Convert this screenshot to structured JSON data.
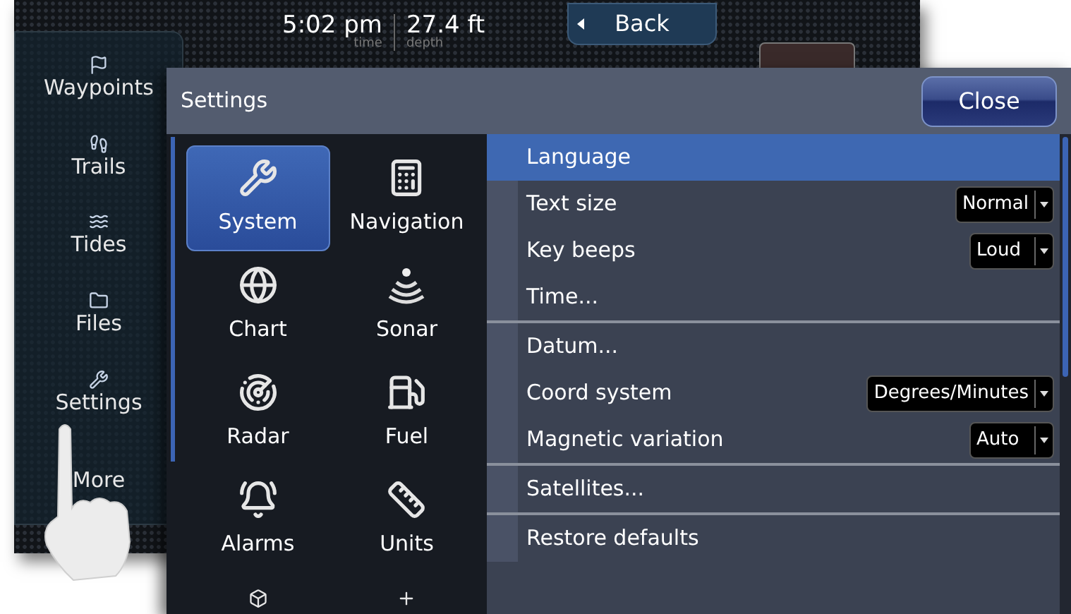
{
  "status": {
    "time": "5:02 pm",
    "time_label": "time",
    "depth": "27.4 ft",
    "depth_label": "depth"
  },
  "back_button": {
    "label": "Back"
  },
  "sidebar": {
    "items": [
      {
        "label": "Waypoints",
        "kind": "waypoints"
      },
      {
        "label": "Trails",
        "kind": "trails"
      },
      {
        "label": "Tides",
        "kind": "tides"
      },
      {
        "label": "Files",
        "kind": "files"
      },
      {
        "label": "Settings",
        "kind": "settings"
      },
      {
        "label": "More",
        "kind": "more"
      }
    ]
  },
  "dialog": {
    "title": "Settings",
    "close_button": "Close",
    "categories": [
      {
        "label": "System",
        "kind": "system",
        "selected": true
      },
      {
        "label": "Navigation",
        "kind": "navigation",
        "selected": false
      },
      {
        "label": "Chart",
        "kind": "chart",
        "selected": false
      },
      {
        "label": "Sonar",
        "kind": "sonar",
        "selected": false
      },
      {
        "label": "Radar",
        "kind": "radar",
        "selected": false
      },
      {
        "label": "Fuel",
        "kind": "fuel",
        "selected": false
      },
      {
        "label": "Alarms",
        "kind": "alarms",
        "selected": false
      },
      {
        "label": "Units",
        "kind": "units",
        "selected": false
      }
    ],
    "groups": [
      [
        {
          "label": "Language",
          "selected": true
        },
        {
          "label": "Text size",
          "value": "Normal",
          "selected": false
        },
        {
          "label": "Key beeps",
          "value": "Loud",
          "selected": false
        },
        {
          "label": "Time...",
          "selected": false
        }
      ],
      [
        {
          "label": "Datum...",
          "selected": false
        },
        {
          "label": "Coord system",
          "value": "Degrees/Minutes",
          "selected": false
        },
        {
          "label": "Magnetic variation",
          "value": "Auto",
          "selected": false
        }
      ],
      [
        {
          "label": "Satellites...",
          "selected": false
        }
      ],
      [
        {
          "label": "Restore defaults",
          "selected": false
        }
      ]
    ]
  }
}
